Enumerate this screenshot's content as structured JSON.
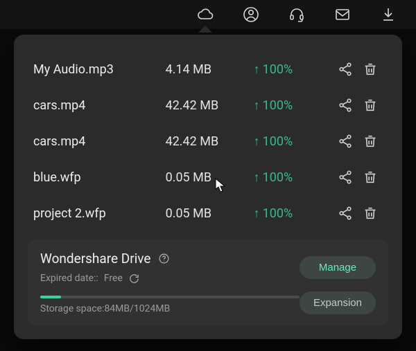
{
  "colors": {
    "accent": "#3db888",
    "progress": "#35d4a5"
  },
  "topbar": {
    "icons": [
      "cloud",
      "profile",
      "headset",
      "mail",
      "download"
    ]
  },
  "files": [
    {
      "name": "My Audio.mp3",
      "size": "4.14 MB",
      "status": "100%"
    },
    {
      "name": "cars.mp4",
      "size": "42.42 MB",
      "status": "100%"
    },
    {
      "name": "cars.mp4",
      "size": "42.42 MB",
      "status": "100%"
    },
    {
      "name": "blue.wfp",
      "size": "0.05 MB",
      "status": "100%"
    },
    {
      "name": "project 2.wfp",
      "size": "0.05 MB",
      "status": "100%"
    }
  ],
  "drive": {
    "title": "Wondershare Drive",
    "expired_label": "Expired date::",
    "expired_value": "Free",
    "manage_label": "Manage",
    "expansion_label": "Expansion",
    "storage_label": "Storage space:",
    "storage_used": "84MB",
    "storage_total": "1024MB",
    "storage_pct": 8
  }
}
